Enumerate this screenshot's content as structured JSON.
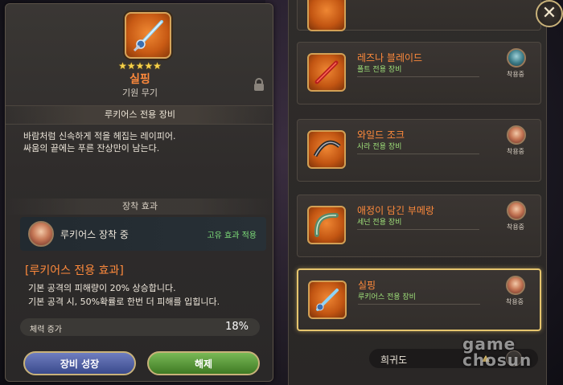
{
  "weapon": {
    "name": "실핑",
    "type": "기원 무기",
    "stars": "★★★★★",
    "exclusive": "루키어스  전용 장비",
    "description": [
      "바람처럼 신속하게 적을 헤집는 레이피어.",
      "싸움의 끝에는 푸른 잔상만이 남는다."
    ]
  },
  "equip": {
    "header": "장착 효과",
    "equipped_text": "루키어스 장착 중",
    "unique_text": "고유 효과 적용"
  },
  "effect": {
    "title": "[루키어스 전용 효과]",
    "lines": [
      "기본 공격의 피해량이 20% 상승합니다.",
      "기본 공격 시, 50%확률로 한번 더 피해를 입힙니다."
    ]
  },
  "stat": {
    "label": "체력 증가",
    "value": "18%"
  },
  "buttons": {
    "grow": "장비 성장",
    "unequip": "해제"
  },
  "list": [
    {
      "name": "레즈나 블레이드",
      "sub": "폴트 전용 장비",
      "equipped": "착용중"
    },
    {
      "name": "와일드 조크",
      "sub": "사라 전용 장비",
      "equipped": "착용중"
    },
    {
      "name": "애정이 담긴 부메랑",
      "sub": "세넌 전용 장비",
      "equipped": "착용중"
    },
    {
      "name": "실핑",
      "sub": "루키어스 전용 장비",
      "equipped": "착용중"
    }
  ],
  "sort": {
    "label": "희귀도"
  },
  "close": "✕",
  "watermark": {
    "line1": "game",
    "line2": "chosun"
  },
  "colors": {
    "accent": "#ff8a3c",
    "highlight": "#e6c56e",
    "green": "#7fe07a"
  }
}
